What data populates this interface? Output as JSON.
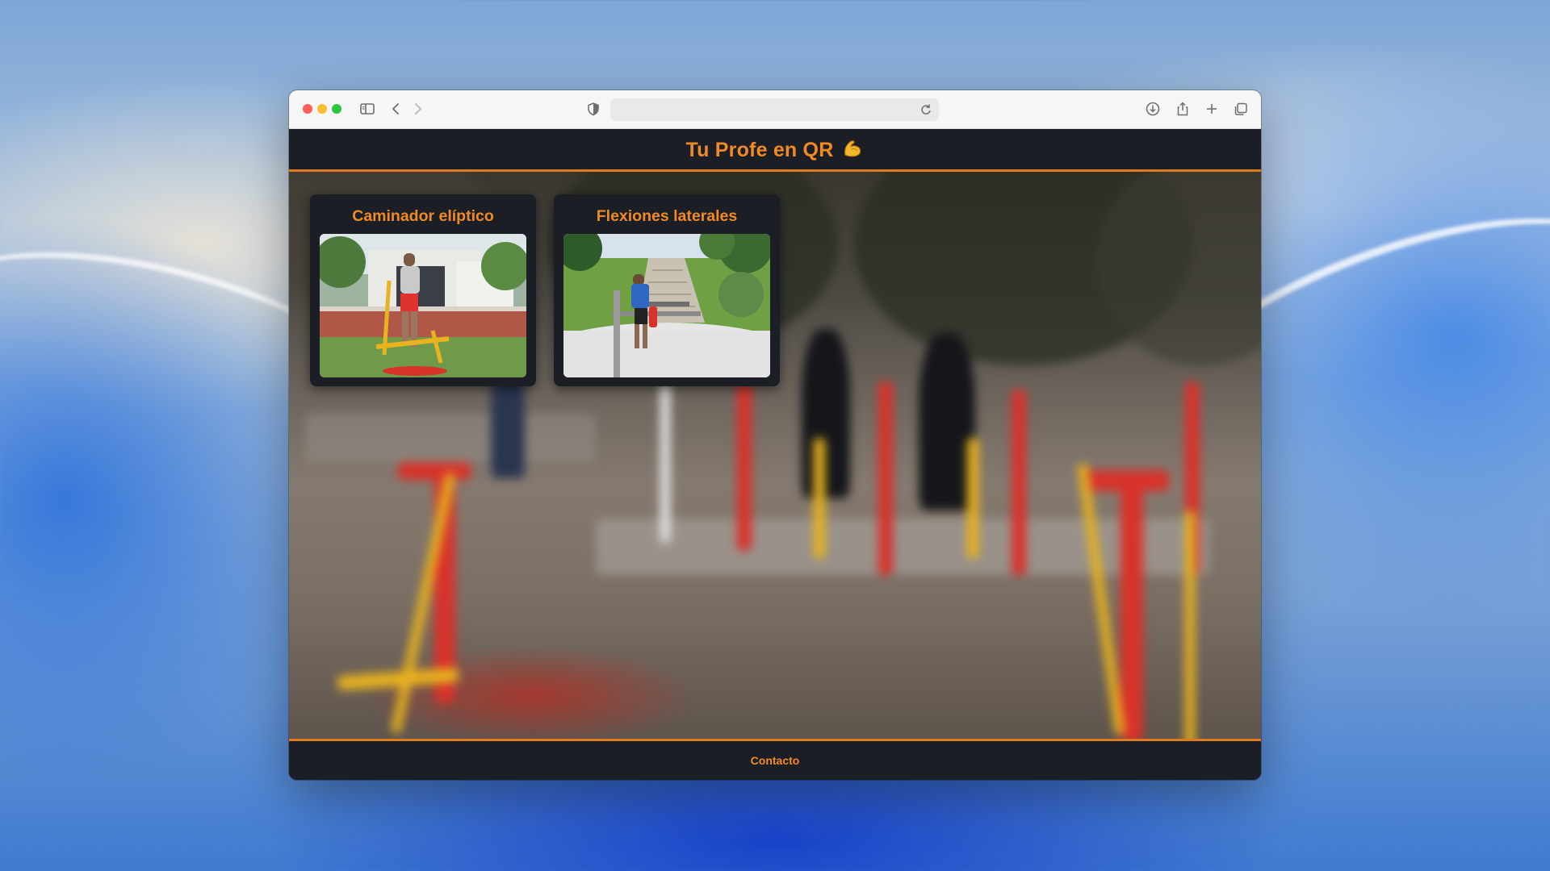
{
  "browser": {
    "address_value": "",
    "icons": [
      "sidebar-icon",
      "back-icon",
      "forward-icon",
      "shield-icon",
      "reload-icon",
      "download-icon",
      "share-icon",
      "plus-icon",
      "tabs-icon"
    ]
  },
  "header": {
    "title": "Tu Profe en QR",
    "icon": "flexed-biceps-icon"
  },
  "exercises": [
    {
      "title": "Caminador elíptico",
      "image": "elliptical-walker-photo"
    },
    {
      "title": "Flexiones laterales",
      "image": "lateral-flexions-photo"
    }
  ],
  "footer": {
    "contact_label": "Contacto"
  },
  "colors": {
    "accent": "#f08a24",
    "dark": "#1c1e26",
    "border": "#e07a1f"
  }
}
